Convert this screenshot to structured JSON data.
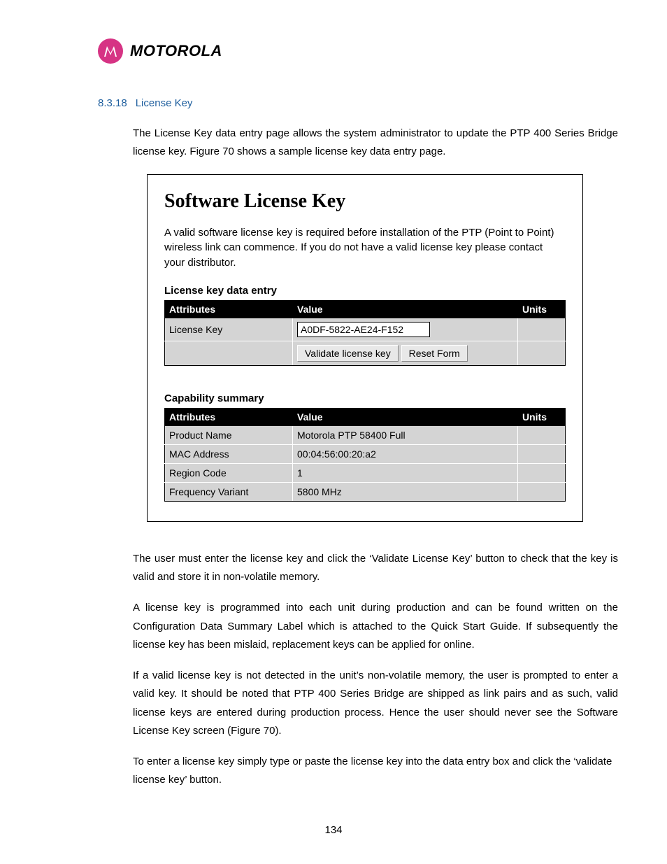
{
  "brand": "MOTOROLA",
  "section": {
    "num": "8.3.18",
    "title": "License Key"
  },
  "para_intro": "The License Key data entry page allows the system administrator to update the PTP 400 Series Bridge license key. Figure 70 shows a sample license key data entry page.",
  "figure": {
    "title": "Software License Key",
    "desc": "A valid software license key is required before installation of the PTP (Point to Point) wireless link can commence. If you do not have a valid license key please contact your distributor.",
    "table1": {
      "label": "License key data entry",
      "headers": {
        "attr": "Attributes",
        "value": "Value",
        "units": "Units"
      },
      "row_attr": "License Key",
      "input_value": "A0DF-5822-AE24-F152",
      "btn_validate": "Validate license key",
      "btn_reset": "Reset Form"
    },
    "table2": {
      "label": "Capability summary",
      "headers": {
        "attr": "Attributes",
        "value": "Value",
        "units": "Units"
      },
      "rows": [
        {
          "attr": "Product Name",
          "value": "Motorola PTP 58400 Full",
          "units": ""
        },
        {
          "attr": "MAC Address",
          "value": "00:04:56:00:20:a2",
          "units": ""
        },
        {
          "attr": "Region Code",
          "value": "1",
          "units": ""
        },
        {
          "attr": "Frequency Variant",
          "value": "5800 MHz",
          "units": ""
        }
      ]
    }
  },
  "para2": "The user must enter the license key and click the ‘Validate License Key’ button to check that the key is valid and store it in non-volatile memory.",
  "para3": "A license key is programmed into each unit during production and can be found written on the Configuration Data Summary Label which is attached to the Quick Start Guide. If subsequently the license key has been mislaid, replacement keys can be applied for online.",
  "para4": "If a valid license key is not detected in the unit’s non-volatile memory, the user is prompted to enter a valid key. It should be noted that PTP 400 Series Bridge are shipped as link pairs and as such, valid license keys are entered during production process. Hence the user should never see the Software License Key screen (Figure 70).",
  "para5": "To enter a license key simply type or paste the license key into the data entry box and click the ‘validate license key’ button.",
  "page_number": "134"
}
